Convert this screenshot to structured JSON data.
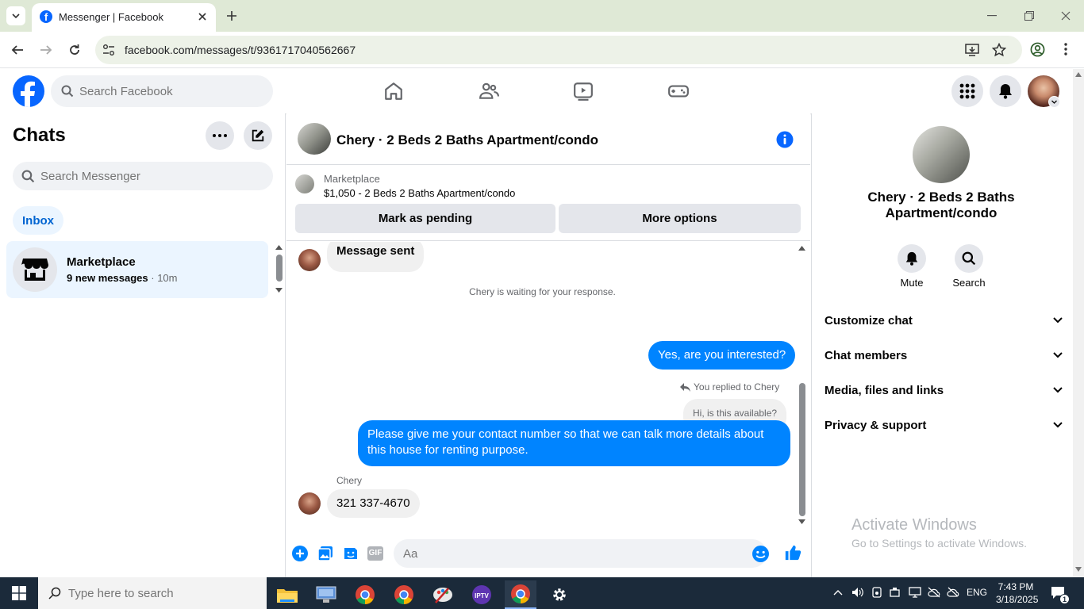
{
  "browser": {
    "tab_title": "Messenger | Facebook",
    "url": "facebook.com/messages/t/9361717040562667"
  },
  "fb_header": {
    "search_placeholder": "Search Facebook"
  },
  "chats": {
    "title": "Chats",
    "search_placeholder": "Search Messenger",
    "inbox_label": "Inbox",
    "items": [
      {
        "name": "Marketplace",
        "preview": "9 new messages",
        "time": "· 10m"
      }
    ]
  },
  "conversation": {
    "title": "Chery · 2 Beds 2 Baths Apartment/condo",
    "listing_source": "Marketplace",
    "listing_title": "$1,050 - 2 Beds 2 Baths Apartment/condo",
    "mark_pending_label": "Mark as pending",
    "more_options_label": "More options",
    "messages": {
      "m1": "Message sent",
      "waiting": "Chery is waiting for your response.",
      "m2": "Yes, are you interested?",
      "replied_to": "You replied to Chery",
      "quoted": "Hi, is this available?",
      "m3": "Please give me your contact number so that we can talk more details about this house for renting purpose.",
      "sender_name": "Chery",
      "m4": "321 337-4670"
    },
    "composer_placeholder": "Aa"
  },
  "details": {
    "name": "Chery · 2 Beds 2 Baths Apartment/condo",
    "mute_label": "Mute",
    "search_label": "Search",
    "sections": [
      "Customize chat",
      "Chat members",
      "Media, files and links",
      "Privacy & support"
    ]
  },
  "watermark": {
    "line1": "Activate Windows",
    "line2": "Go to Settings to activate Windows."
  },
  "taskbar": {
    "search_placeholder": "Type here to search",
    "lang": "ENG",
    "time": "7:43 PM",
    "date": "3/18/2025",
    "notif_count": "1"
  },
  "colors": {
    "accent": "#0084ff",
    "fb_blue": "#0866ff"
  }
}
